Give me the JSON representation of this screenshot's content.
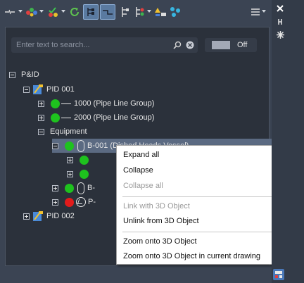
{
  "search": {
    "placeholder": "Enter text to search..."
  },
  "toggle": {
    "label": "Off"
  },
  "toolbar": {
    "buttons": [
      {
        "name": "line-filter-icon"
      },
      {
        "name": "color-dots-icon"
      },
      {
        "name": "check-filter-icon"
      },
      {
        "name": "refresh-icon"
      },
      {
        "name": "tree-view-icon",
        "active": true
      },
      {
        "name": "pipe-view-icon",
        "active": true
      },
      {
        "name": "hierarchy-icon"
      },
      {
        "name": "tree-dropdown-icon"
      },
      {
        "name": "warning-icon"
      },
      {
        "name": "network-icon"
      },
      {
        "name": "menu-icon"
      }
    ]
  },
  "tree": {
    "root": "P&ID",
    "pid001": "PID 001",
    "line1000": "1000 (Pipe Line Group)",
    "line2000": "2000 (Pipe Line Group)",
    "equipment": "Equipment",
    "vessel": "B-001 (Dished Heads Vessel)",
    "b_item": "B-",
    "p_item": "P-",
    "pid002": "PID 002"
  },
  "context_menu": {
    "items": [
      {
        "label": "Expand all",
        "enabled": true
      },
      {
        "label": "Collapse",
        "enabled": true
      },
      {
        "label": "Collapse all",
        "enabled": false
      },
      {
        "label": "Link with 3D Object",
        "enabled": false
      },
      {
        "label": "Unlink from 3D Object",
        "enabled": true
      },
      {
        "label": "Zoom onto 3D Object",
        "enabled": true
      },
      {
        "label": "Zoom onto 3D Object in current drawing",
        "enabled": true
      }
    ]
  },
  "colors": {
    "panel": "#3b4453",
    "tree_bg": "#2b313b",
    "status_ok": "#1ec21e",
    "status_error": "#e21b1b",
    "selection": "#5b6a82"
  }
}
